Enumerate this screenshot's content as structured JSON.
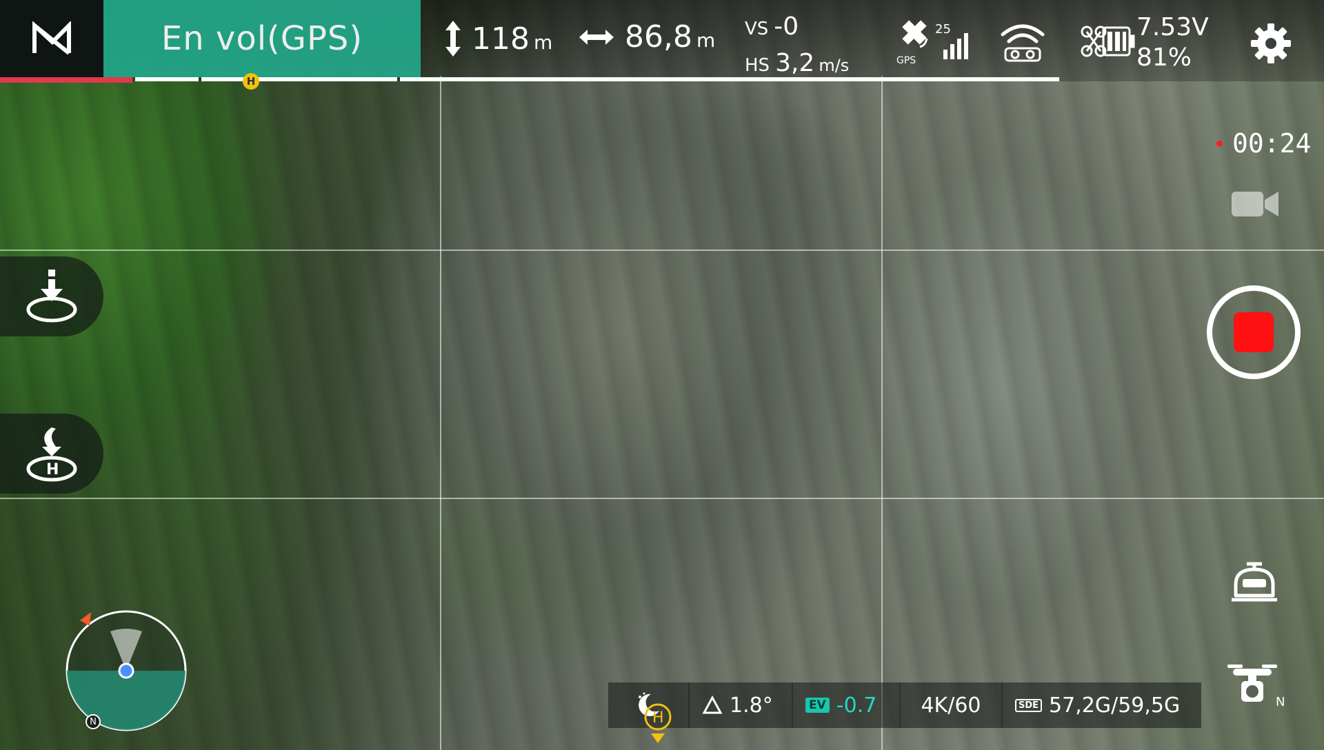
{
  "app": {
    "status": "En  vol(GPS)"
  },
  "telemetry": {
    "altitude_value": "118",
    "altitude_unit": "m",
    "distance_value": "86,8",
    "distance_unit": "m",
    "vs_label": "VS",
    "vs_value": "-0",
    "hs_label": "HS",
    "hs_value": "3,2",
    "hs_unit": "m/s",
    "gps_label": "GPS",
    "satellites": "25",
    "battery_voltage": "7.53V",
    "battery_percent": "81%"
  },
  "flight_progress": {
    "home_marker": "H"
  },
  "recording": {
    "time": "00:24"
  },
  "camera_status": {
    "tilt": "1.8°",
    "ev_label": "EV",
    "ev_value": "-0.7",
    "resolution": "4K/60",
    "sd_label": "SDE",
    "storage": "57,2G/59,5G"
  },
  "radar": {
    "north_label": "N"
  },
  "gimbal": {
    "north_label": "N"
  },
  "colors": {
    "status_bg": "#23a88a",
    "record_red": "#ff1111",
    "ev_accent": "#22d9c4",
    "home_yellow": "#f1c20f",
    "progress_red": "#e2384b"
  },
  "icons": [
    "brand-logo-icon",
    "altitude-icon",
    "distance-icon",
    "gps-signal-icon",
    "wifi-link-icon",
    "drone-battery-icon",
    "settings-gear-icon",
    "video-mode-icon",
    "record-stop-icon",
    "landing-icon",
    "return-home-icon",
    "night-mode-icon",
    "tilt-icon",
    "sd-card-icon",
    "home-point-icon",
    "camera-settings-icon",
    "gimbal-camera-icon"
  ]
}
